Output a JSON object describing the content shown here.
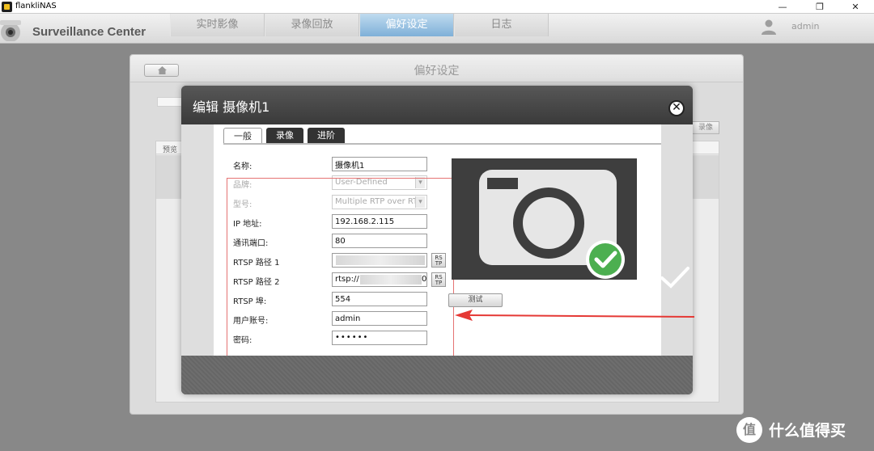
{
  "window": {
    "title": "flankliNAS",
    "controls": [
      "—",
      "❐",
      "✕"
    ]
  },
  "header": {
    "app_name": "Surveillance Center",
    "tabs": [
      {
        "label": "实时影像",
        "active": false
      },
      {
        "label": "录像回放",
        "active": false
      },
      {
        "label": "偏好设定",
        "active": true
      },
      {
        "label": "日志",
        "active": false
      }
    ],
    "user": "admin"
  },
  "panel": {
    "title": "偏好设定",
    "column_label": "预览",
    "record_button": "录像"
  },
  "dialog": {
    "title": "编辑 摄像机1",
    "close_symbol": "✕",
    "tabs": [
      {
        "label": "一般",
        "active": true
      },
      {
        "label": "录像",
        "active": false
      },
      {
        "label": "进阶",
        "active": false
      }
    ],
    "fields": {
      "name": {
        "label": "名称:",
        "value": "摄像机1"
      },
      "brand": {
        "label": "品牌:",
        "value": "User-Defined"
      },
      "model": {
        "label": "型号:",
        "value": "Multiple RTP over RTS"
      },
      "ip": {
        "label": "IP 地址:",
        "value": "192.168.2.115"
      },
      "port": {
        "label": "通讯端口:",
        "value": "80"
      },
      "rtsp1": {
        "label": "RTSP 路径 1",
        "value": "",
        "btn": "RS\nTP"
      },
      "rtsp2": {
        "label": "RTSP 路径 2",
        "value": "rtsp://",
        "value_tail": "0",
        "btn": "RS\nTP"
      },
      "rtsp_port": {
        "label": "RTSP 埠:",
        "value": "554"
      },
      "username": {
        "label": "用户账号:",
        "value": "admin"
      },
      "password": {
        "label": "密码:",
        "value": "••••••"
      }
    },
    "test_button": "测试"
  },
  "colors": {
    "active_tab": "#7fb0d8",
    "arrow": "#e53935",
    "check_green": "#4caf50"
  },
  "watermark": {
    "logo": "值",
    "text": "什么值得买"
  }
}
